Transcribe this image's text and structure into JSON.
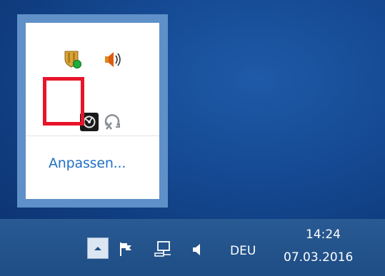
{
  "tray_overflow": {
    "icons": [
      {
        "name": "security-shield-icon"
      },
      {
        "name": "speaker-icon"
      },
      {
        "name": "app-tray-icon"
      },
      {
        "name": "network-disconnected-icon"
      }
    ],
    "customize_label": "Anpassen..."
  },
  "taskbar": {
    "show_hidden_icons": "chevron-up-icon",
    "action_center": "flag-icon",
    "network": "network-monitor-icon",
    "volume": "speaker-icon",
    "language": "DEU",
    "time": "14:24",
    "date": "07.03.2016"
  },
  "colors": {
    "highlight": "#e8142a",
    "link": "#1f6fc4",
    "popup_border": "#5f90c8",
    "taskbar": "#1e4d85"
  }
}
